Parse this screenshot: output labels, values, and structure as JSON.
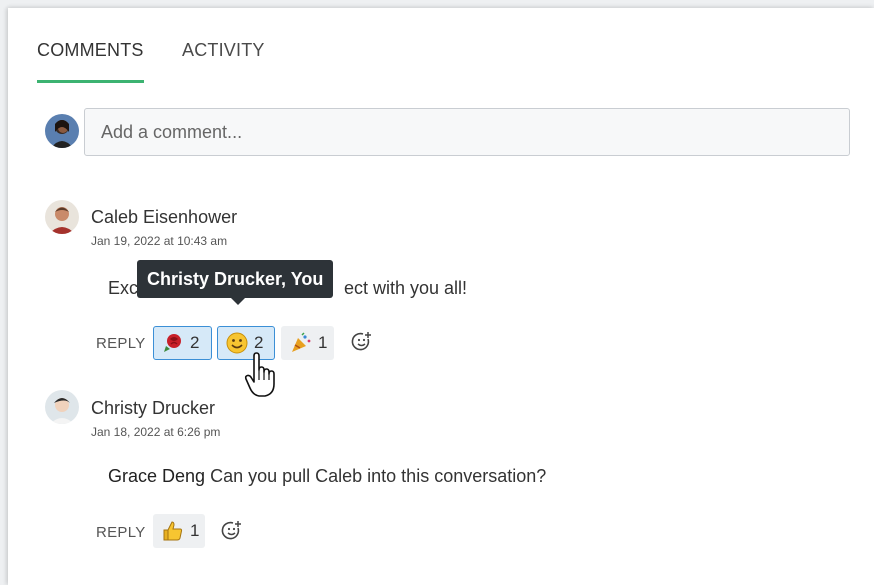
{
  "tabs": [
    {
      "label": "COMMENTS",
      "active": true
    },
    {
      "label": "ACTIVITY",
      "active": false
    }
  ],
  "composer": {
    "placeholder": "Add a comment..."
  },
  "comments": [
    {
      "author": "Caleb Eisenhower",
      "timestamp": "Jan 19, 2022 at 10:43 am",
      "text_before": "Exci",
      "text_after": "ect with you all!",
      "reply_label": "REPLY",
      "reactions": [
        {
          "icon": "rose-emoji-icon",
          "count": "2",
          "mine": true
        },
        {
          "icon": "smiley-emoji-icon",
          "count": "2",
          "mine": true
        },
        {
          "icon": "party-popper-emoji-icon",
          "count": "1",
          "mine": false
        }
      ]
    },
    {
      "author": "Christy Drucker",
      "timestamp": "Jan 18, 2022 at 6:26 pm",
      "mention": "Grace Deng",
      "text": " Can you pull Caleb into this conversation?",
      "reply_label": "REPLY",
      "reactions": [
        {
          "icon": "thumbs-up-emoji-icon",
          "count": "1",
          "mine": false
        }
      ]
    }
  ],
  "tooltip": {
    "text": "Christy Drucker, You"
  },
  "colors": {
    "tab_underline": "#3cb371",
    "tooltip_bg": "#2d3338",
    "reaction_selected_bg": "#d6e9f8",
    "reaction_selected_border": "#3b8fd6"
  }
}
